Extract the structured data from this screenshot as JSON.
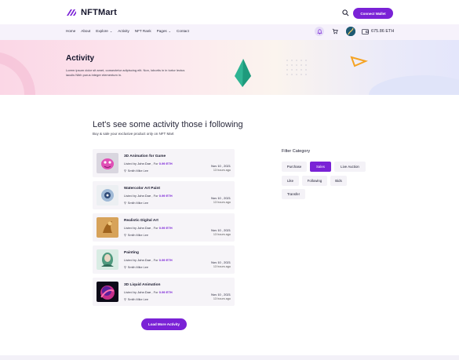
{
  "brand": {
    "name": "NFTMart",
    "accent": "#7a22d6"
  },
  "header": {
    "connect_label": "Connect Wallet"
  },
  "nav": {
    "items": [
      {
        "label": "Home",
        "has_dropdown": false
      },
      {
        "label": "About",
        "has_dropdown": false
      },
      {
        "label": "Explore",
        "has_dropdown": true
      },
      {
        "label": "Activity",
        "has_dropdown": false
      },
      {
        "label": "NFT Rank",
        "has_dropdown": false
      },
      {
        "label": "Pages",
        "has_dropdown": true
      },
      {
        "label": "Contact",
        "has_dropdown": false
      }
    ],
    "balance": "675.86 ETH"
  },
  "hero": {
    "title": "Activity",
    "subtitle": "Lorem ipsum dolor sit amet, consectetur adipiscing elit. Non, lobortis in in tortor lectus iaculis Nibh purus integer elementum in."
  },
  "section": {
    "title": "Let's see some activity those i following",
    "subtitle": "Buy & sale your exclusive product only on NFT Mart"
  },
  "activities": [
    {
      "title": "3D Animation for Game",
      "listed_prefix": "Listed by",
      "lister": "John Doe",
      "for_text": ", For",
      "price": "0.99 ETH",
      "author": "Smith Mike Lee",
      "date": "Nov 10 , 2021",
      "ago": "13 hours ago",
      "icon": "pink-creature-art"
    },
    {
      "title": "Watercolor Art Paint",
      "listed_prefix": "Listed by",
      "lister": "John Doe",
      "for_text": ", For",
      "price": "0.99 ETH",
      "author": "Smith Mike Lee",
      "date": "Nov 10 , 2021",
      "ago": "13 hours ago",
      "icon": "watercolor-art"
    },
    {
      "title": "Realistic Digital Art",
      "listed_prefix": "Listed by",
      "lister": "John Doe",
      "for_text": ", For",
      "price": "0.99 ETH",
      "author": "Smith Mike Lee",
      "date": "Nov 10 , 2021",
      "ago": "13 hours ago",
      "icon": "digital-art"
    },
    {
      "title": "Painting",
      "listed_prefix": "Listed by",
      "lister": "John Doe",
      "for_text": ", For",
      "price": "0.99 ETH",
      "author": "Smith Mike Lee",
      "date": "Nov 10 , 2021",
      "ago": "13 hours ago",
      "icon": "painting-art"
    },
    {
      "title": "3D Liquid Animation",
      "listed_prefix": "Listed by",
      "lister": "John Doe",
      "for_text": ", For",
      "price": "0.99 ETH",
      "author": "Smith Mike Lee",
      "date": "Nov 10 , 2021",
      "ago": "13 hours ago",
      "icon": "liquid-art"
    }
  ],
  "load_more_label": "Load More Activity",
  "filter": {
    "title": "Filter Category",
    "chips": [
      {
        "label": "Purchase",
        "active": false
      },
      {
        "label": "Sales",
        "active": true
      },
      {
        "label": "Live Auction",
        "active": false
      },
      {
        "label": "Like",
        "active": false
      },
      {
        "label": "Following",
        "active": false
      },
      {
        "label": "Bids",
        "active": false
      },
      {
        "label": "Transfer",
        "active": false
      }
    ]
  }
}
